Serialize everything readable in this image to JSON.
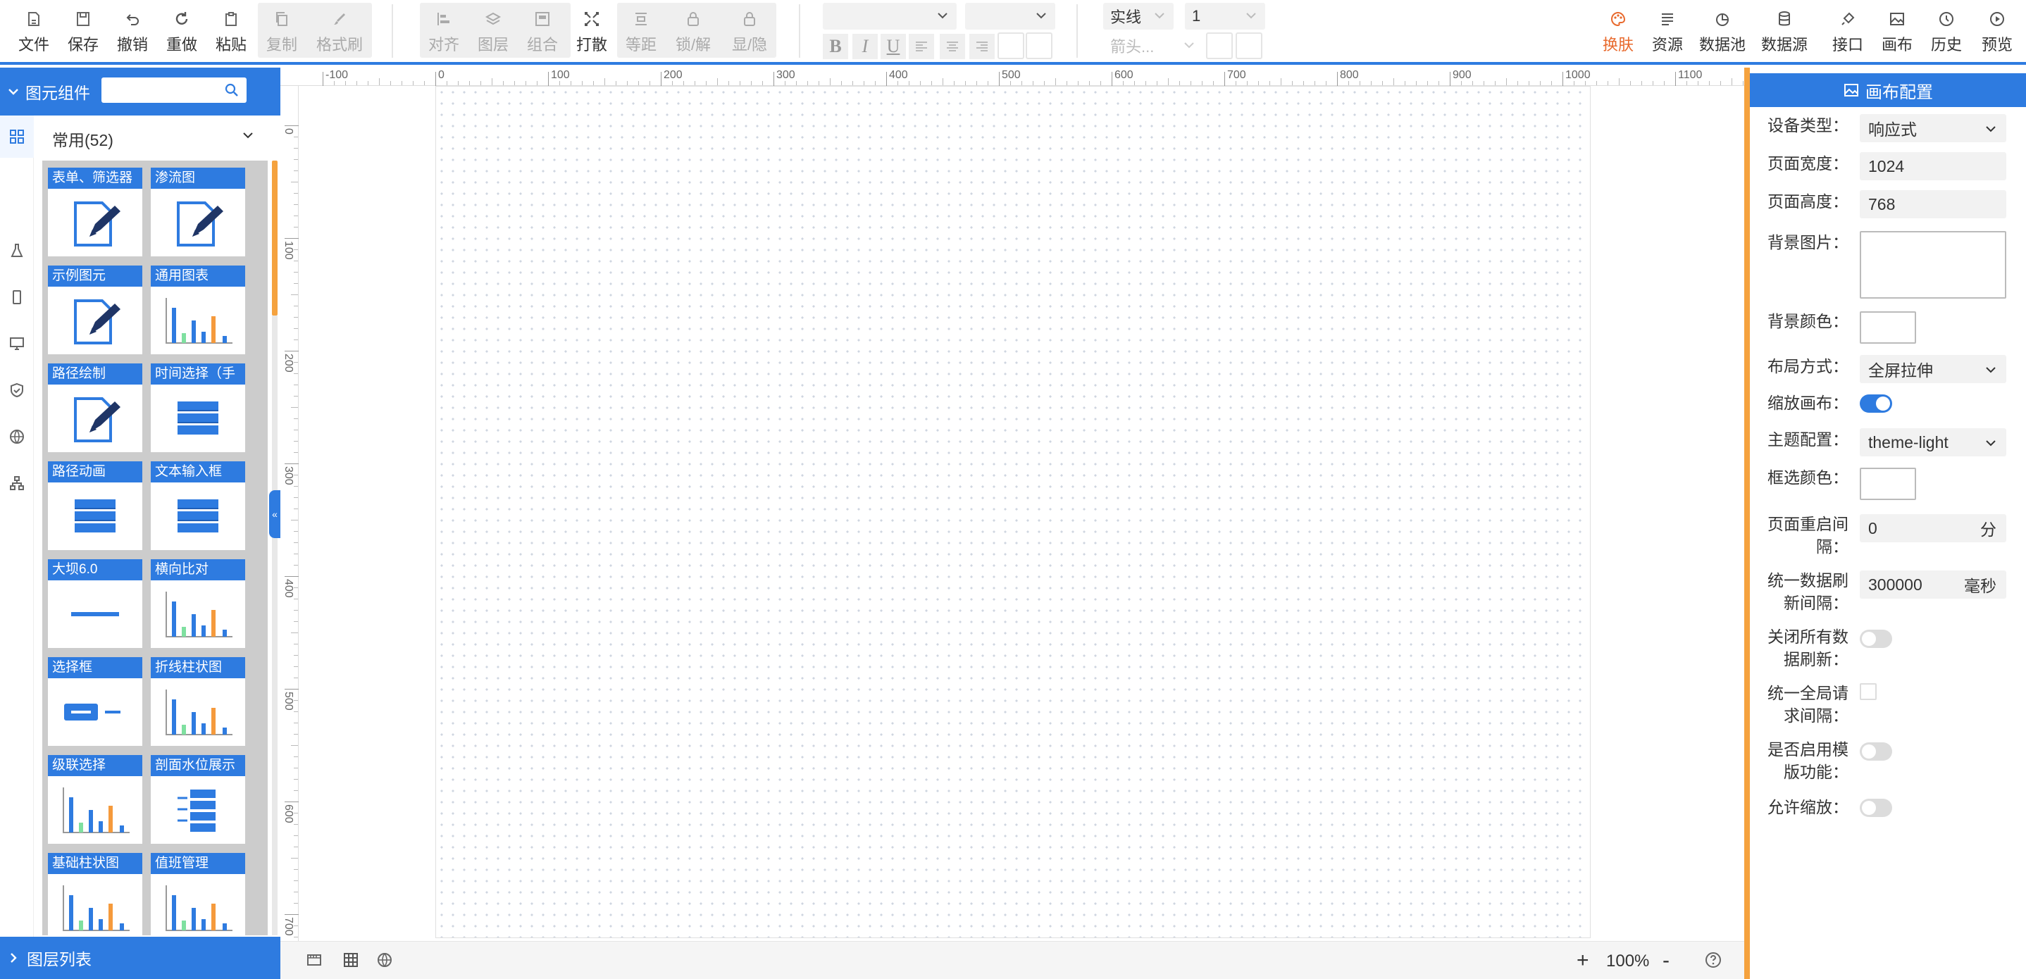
{
  "toolbar": {
    "left_buttons": [
      {
        "name": "file",
        "label": "文件",
        "icon": "file-icon"
      },
      {
        "name": "save",
        "label": "保存",
        "icon": "save-icon"
      },
      {
        "name": "undo",
        "label": "撤销",
        "icon": "undo-icon"
      },
      {
        "name": "redo",
        "label": "重做",
        "icon": "redo-icon"
      },
      {
        "name": "paste",
        "label": "粘贴",
        "icon": "paste-icon"
      },
      {
        "name": "copy",
        "label": "复制",
        "icon": "copy-icon",
        "disabled": true
      },
      {
        "name": "format-brush",
        "label": "格式刷",
        "icon": "brush-icon",
        "disabled": true
      }
    ],
    "arrange_buttons": [
      {
        "name": "align",
        "label": "对齐",
        "icon": "align-icon",
        "disabled": true
      },
      {
        "name": "layer",
        "label": "图层",
        "icon": "layers-icon",
        "disabled": true
      },
      {
        "name": "group",
        "label": "组合",
        "icon": "group-icon",
        "disabled": true
      },
      {
        "name": "ungroup",
        "label": "打散",
        "icon": "scatter-icon"
      },
      {
        "name": "spacing",
        "label": "等距",
        "icon": "spacing-icon",
        "disabled": true
      },
      {
        "name": "lock",
        "label": "锁/解",
        "icon": "lock-icon",
        "disabled": true
      },
      {
        "name": "visibility",
        "label": "显/隐",
        "icon": "lock-icon",
        "disabled": true
      }
    ],
    "format": {
      "bold": "B",
      "italic": "I",
      "underline": "U",
      "line_style": "实线",
      "line_width": "1",
      "arrow_placeholder": "箭头..."
    },
    "right_buttons": [
      {
        "name": "skin",
        "label": "换肤",
        "icon": "palette-icon",
        "active": true
      },
      {
        "name": "resources",
        "label": "资源",
        "icon": "list-icon"
      },
      {
        "name": "data-pool",
        "label": "数据池",
        "icon": "pie-icon"
      },
      {
        "name": "data-source",
        "label": "数据源",
        "icon": "database-icon"
      },
      {
        "name": "api",
        "label": "接口",
        "icon": "plug-icon"
      },
      {
        "name": "canvas",
        "label": "画布",
        "icon": "image-icon"
      },
      {
        "name": "history",
        "label": "历史",
        "icon": "clock-icon"
      },
      {
        "name": "preview",
        "label": "预览",
        "icon": "play-icon"
      }
    ]
  },
  "left_panel": {
    "title": "图元组件",
    "search_placeholder": "",
    "category": "常用(52)",
    "components": [
      {
        "label": "表单、筛选器",
        "thumb": "edit-doc"
      },
      {
        "label": "渗流图",
        "thumb": "edit-doc"
      },
      {
        "label": "示例图元",
        "thumb": "edit-doc"
      },
      {
        "label": "通用图表",
        "thumb": "bar-chart"
      },
      {
        "label": "路径绘制",
        "thumb": "edit-doc"
      },
      {
        "label": "时间选择（手",
        "thumb": "stack"
      },
      {
        "label": "路径动画",
        "thumb": "stack"
      },
      {
        "label": "文本输入框",
        "thumb": "stack"
      },
      {
        "label": "大坝6.0",
        "thumb": "line"
      },
      {
        "label": "横向比对",
        "thumb": "bar-chart"
      },
      {
        "label": "选择框",
        "thumb": "select"
      },
      {
        "label": "折线柱状图",
        "thumb": "bar-chart"
      },
      {
        "label": "级联选择",
        "thumb": "bar-chart"
      },
      {
        "label": "剖面水位展示",
        "thumb": "water"
      },
      {
        "label": "基础柱状图",
        "thumb": "bar-chart"
      },
      {
        "label": "值班管理",
        "thumb": "bar-chart"
      }
    ],
    "layer_list_title": "图层列表"
  },
  "ruler": {
    "top_ticks": [
      "-100",
      "0",
      "100",
      "200",
      "300",
      "400",
      "500",
      "600",
      "700",
      "800",
      "900",
      "1000",
      "1100"
    ],
    "left_ticks": [
      "0",
      "100",
      "200",
      "300",
      "400",
      "500",
      "600",
      "700"
    ]
  },
  "bottom_bar": {
    "zoom": "100%",
    "plus": "+",
    "minus": "-"
  },
  "right_panel": {
    "title": "画布配置",
    "fields": {
      "device_type": {
        "label": "设备类型：",
        "value": "响应式"
      },
      "page_width": {
        "label": "页面宽度：",
        "value": "1024"
      },
      "page_height": {
        "label": "页面高度：",
        "value": "768"
      },
      "bg_image": {
        "label": "背景图片："
      },
      "bg_color": {
        "label": "背景颜色："
      },
      "layout": {
        "label": "布局方式：",
        "value": "全屏拉伸"
      },
      "scale_canvas": {
        "label": "缩放画布：",
        "on": true
      },
      "theme": {
        "label": "主题配置：",
        "value": "theme-light"
      },
      "select_color": {
        "label": "框选颜色："
      },
      "restart_interval": {
        "label_l1": "页面重启间",
        "label_l2": "隔：",
        "value": "0",
        "unit": "分"
      },
      "refresh_interval": {
        "label_l1": "统一数据刷",
        "label_l2": "新间隔：",
        "value": "300000",
        "unit": "毫秒"
      },
      "close_refresh": {
        "label_l1": "关闭所有数",
        "label_l2": "据刷新：",
        "on": false
      },
      "global_request": {
        "label_l1": "统一全局请",
        "label_l2": "求间隔："
      },
      "template": {
        "label_l1": "是否启用模",
        "label_l2": "版功能：",
        "on": false
      },
      "allow_zoom": {
        "label": "允许缩放：",
        "on": false
      }
    }
  },
  "colors": {
    "primary": "#2e7be0",
    "accent": "#f5a23e",
    "skin_active": "#e8692c"
  }
}
